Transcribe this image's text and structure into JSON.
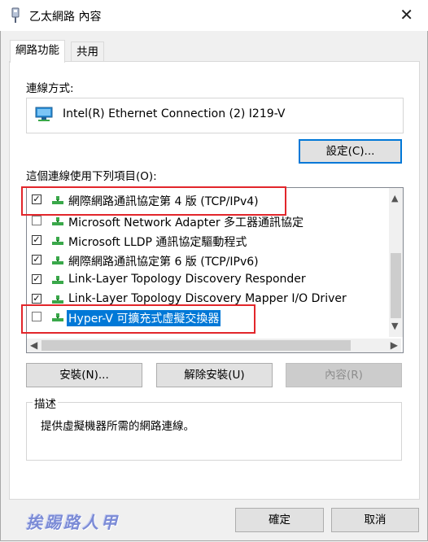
{
  "window": {
    "title": "乙太網路 內容",
    "close_glyph": "✕"
  },
  "tabs": [
    {
      "label": "網路功能",
      "active": true
    },
    {
      "label": "共用",
      "active": false
    }
  ],
  "connect_using": {
    "label": "連線方式:",
    "adapter_name": "Intel(R) Ethernet Connection (2) I219-V"
  },
  "buttons": {
    "configure": "設定(C)...",
    "install": "安裝(N)...",
    "uninstall": "解除安裝(U)",
    "properties": "內容(R)",
    "ok": "確定",
    "cancel": "取消"
  },
  "items_label": "這個連線使用下列項目(O):",
  "items": [
    {
      "label": "網際網路通訊協定第 4 版 (TCP/IPv4)",
      "checked": true,
      "selected": false
    },
    {
      "label": "Microsoft Network Adapter 多工器通訊協定",
      "checked": false,
      "selected": false
    },
    {
      "label": "Microsoft LLDP 通訊協定驅動程式",
      "checked": true,
      "selected": false
    },
    {
      "label": "網際網路通訊協定第 6 版 (TCP/IPv6)",
      "checked": true,
      "selected": false
    },
    {
      "label": "Link-Layer Topology Discovery Responder",
      "checked": true,
      "selected": false
    },
    {
      "label": "Link-Layer Topology Discovery Mapper I/O Driver",
      "checked": true,
      "selected": false
    },
    {
      "label": "Hyper-V 可擴充式虛擬交換器",
      "checked": false,
      "selected": true
    }
  ],
  "description": {
    "legend": "描述",
    "text": "提供虛擬機器所需的網路連線。"
  },
  "watermark": "挨踢路人甲",
  "colors": {
    "selection": "#0078d7",
    "annotation_red": "#e2262b",
    "protocol_icon_green": "#3aa84a"
  },
  "icons": {
    "app": "network-adapter-icon",
    "adapter": "network-card-icon",
    "item": "protocol-icon"
  }
}
